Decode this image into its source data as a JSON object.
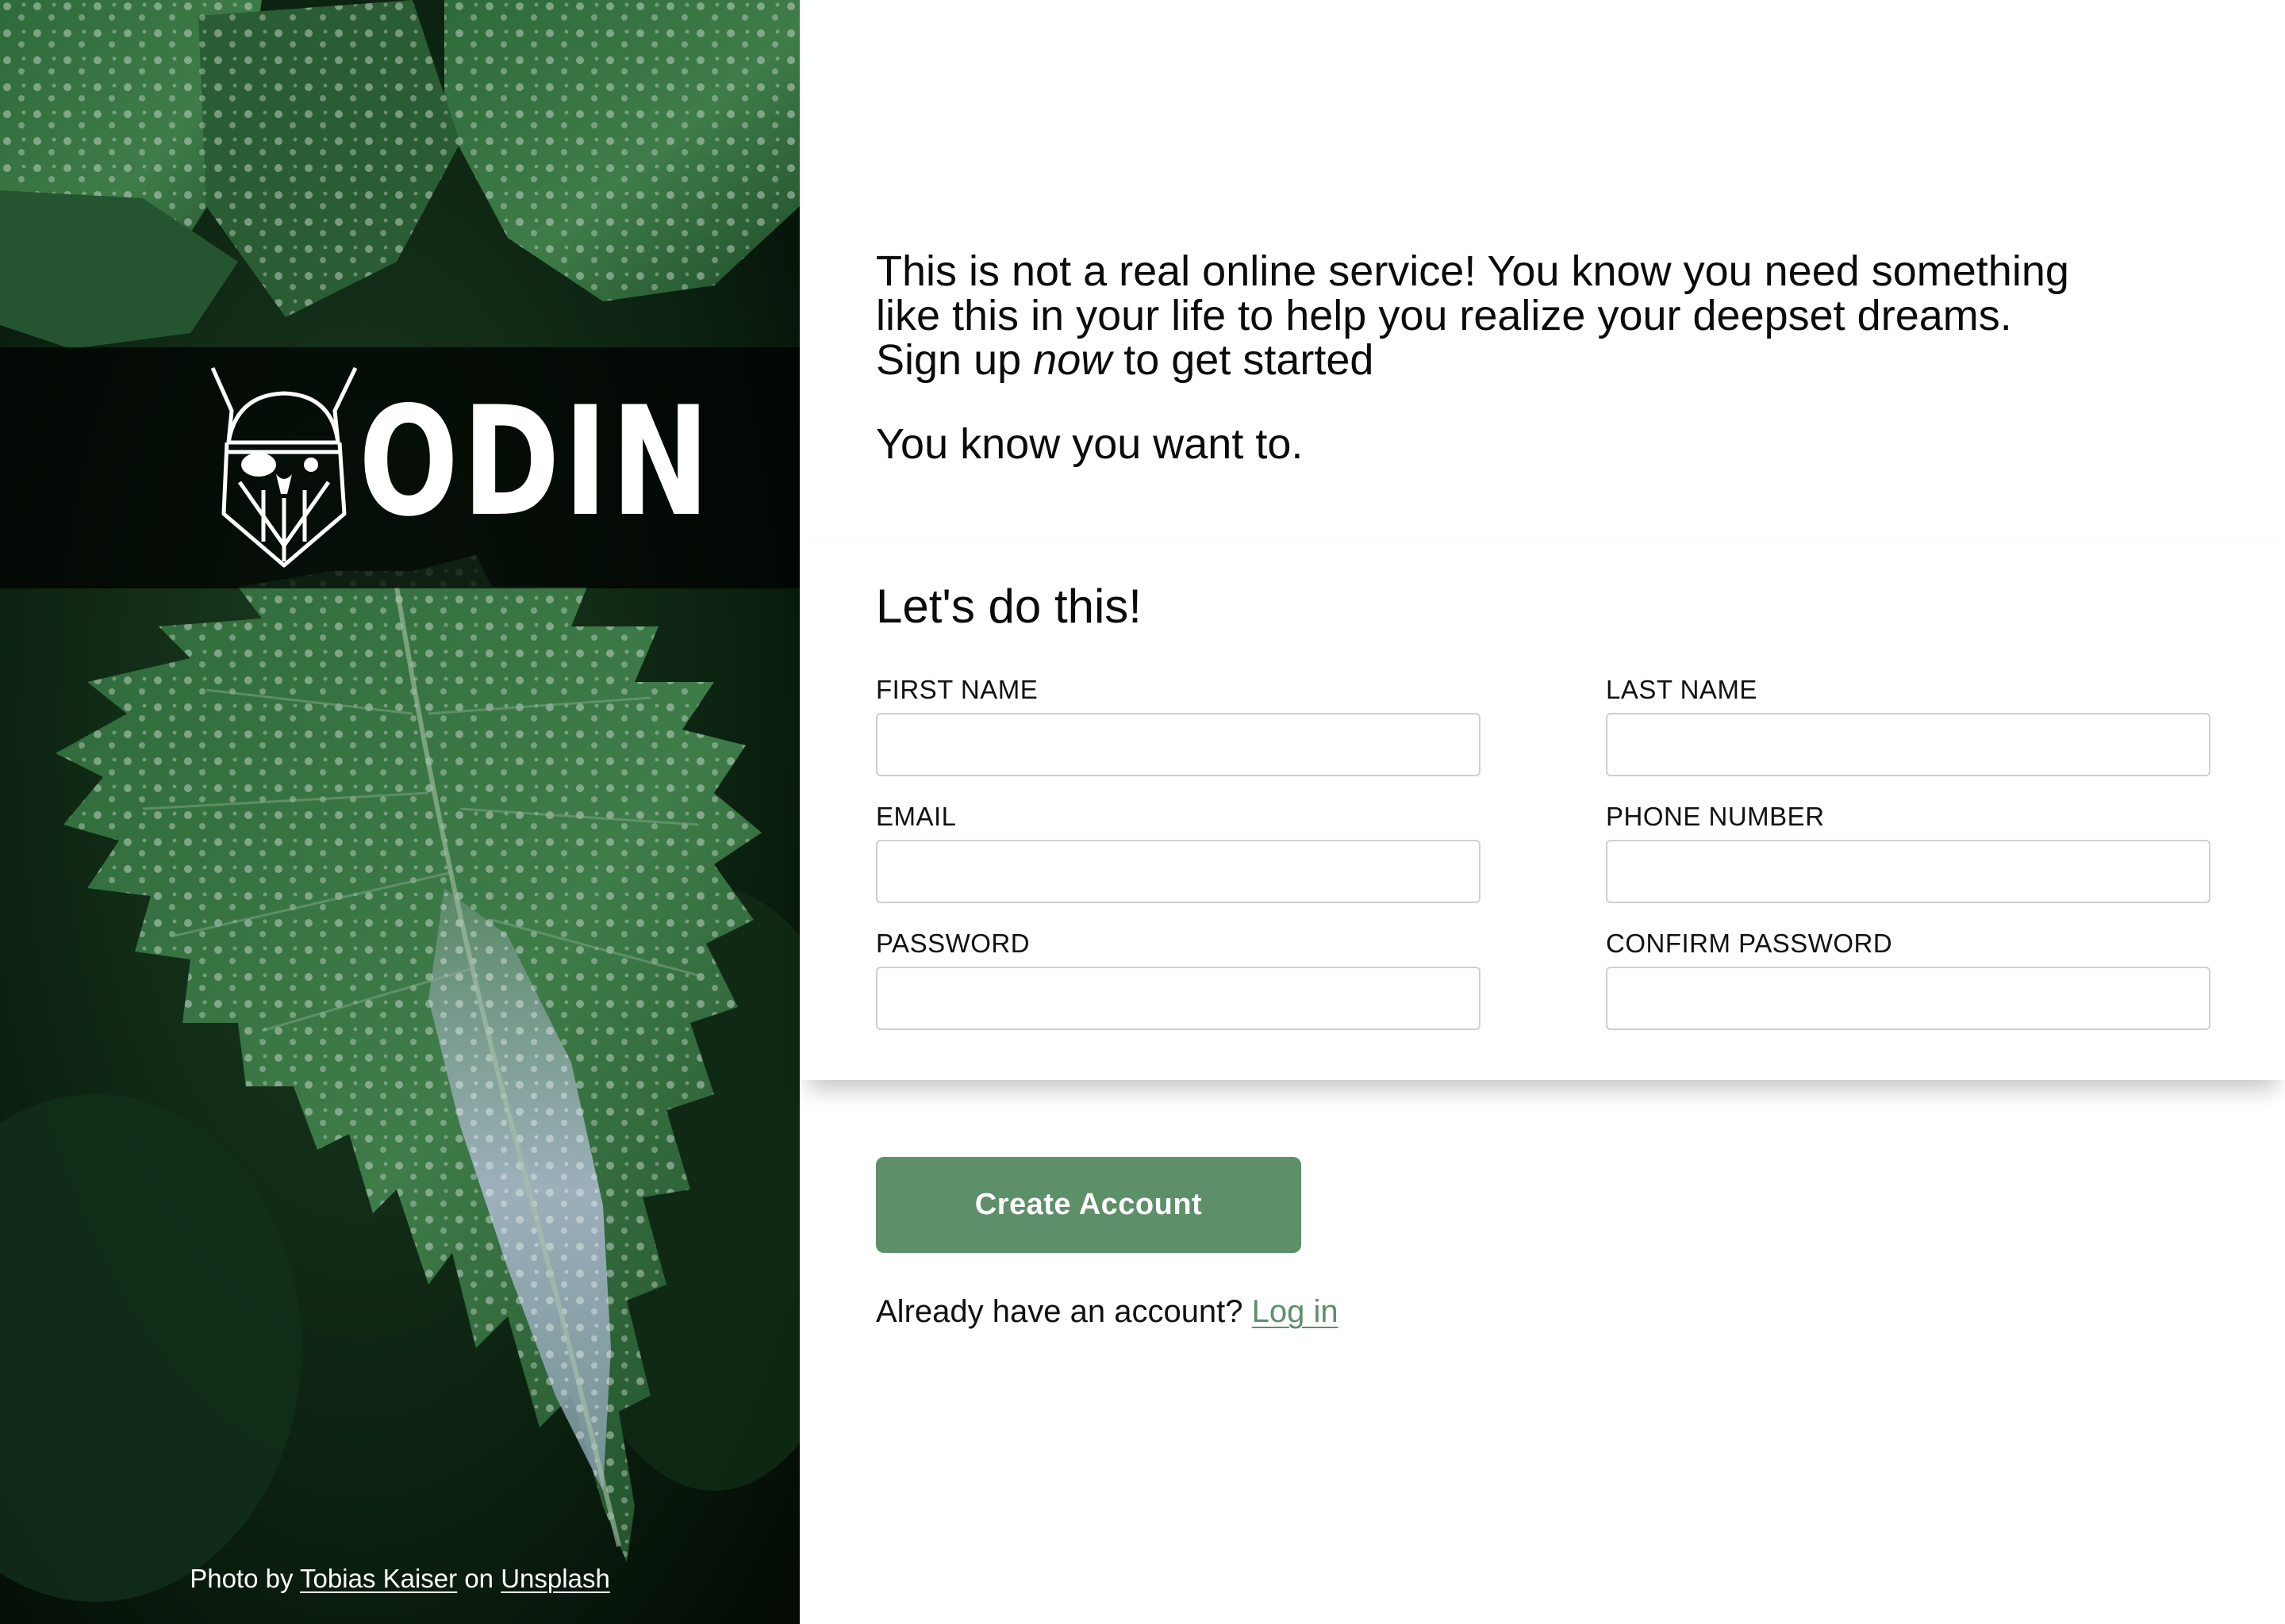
{
  "brand": {
    "name": "ODIN",
    "logo_icon": "viking-head-icon"
  },
  "photo_credit": {
    "prefix": "Photo by",
    "author": "Tobias Kaiser",
    "middle": "on",
    "source": "Unsplash"
  },
  "intro": {
    "line1": "This is not a real online service! You know you need something",
    "line2": "like this in your life to help you realize your deepset dreams.",
    "line3_before": "Sign up ",
    "line3_emphasis": "now",
    "line3_after": " to get started",
    "tagline": "You know you want to."
  },
  "form": {
    "title": "Let's do this!",
    "fields": {
      "first_name": {
        "label": "FIRST NAME",
        "value": ""
      },
      "last_name": {
        "label": "LAST NAME",
        "value": ""
      },
      "email": {
        "label": "EMAIL",
        "value": ""
      },
      "phone": {
        "label": "PHONE NUMBER",
        "value": ""
      },
      "password": {
        "label": "PASSWORD",
        "value": ""
      },
      "confirm_password": {
        "label": "CONFIRM PASSWORD",
        "value": ""
      }
    }
  },
  "actions": {
    "create_account": "Create Account",
    "login_prompt": "Already have an account?",
    "login_link": "Log in"
  },
  "colors": {
    "accent": "#5d8f69",
    "leaf_dark": "#0a1f0e",
    "leaf_mid": "#2f6a3a",
    "leaf_light": "#b9c6d6"
  }
}
